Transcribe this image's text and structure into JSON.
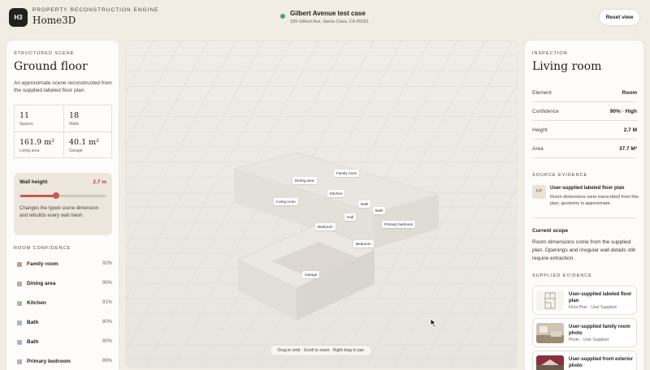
{
  "header": {
    "logo_text": "H3",
    "eyebrow": "PROPERTY RECONSTRUCTION ENGINE",
    "brand": "Home3D",
    "case_title": "Gilbert Avenue test case",
    "case_address": "189 Gilbert Ave, Santa Clara, CA 95051",
    "case_status_color": "#4fa36a",
    "reset_label": "Reset view"
  },
  "scene": {
    "eyebrow": "STRUCTURED SCENE",
    "title": "Ground floor",
    "description": "An approximate scene reconstructed from the supplied labeled floor plan.",
    "stats": [
      {
        "value": "11",
        "label": "Spaces"
      },
      {
        "value": "18",
        "label": "Walls"
      },
      {
        "value": "161.9 m²",
        "label": "Living area"
      },
      {
        "value": "40.1 m²",
        "label": "Garage"
      }
    ],
    "wall_height": {
      "label": "Wall height",
      "value_text": "2.7 m",
      "level_fraction": 0.42,
      "description": "Changes the typed scene dimension and rebuilds every wall mesh."
    },
    "room_confidence_title": "ROOM CONFIDENCE",
    "rooms": [
      {
        "name": "Family room",
        "pct": "92%",
        "color": "#b9a48c"
      },
      {
        "name": "Dining area",
        "pct": "90%",
        "color": "#c7aa94"
      },
      {
        "name": "Kitchen",
        "pct": "91%",
        "color": "#a9bba0"
      },
      {
        "name": "Bath",
        "pct": "80%",
        "color": "#a7b7c3"
      },
      {
        "name": "Bath",
        "pct": "80%",
        "color": "#a7b7c3"
      },
      {
        "name": "Primary bedroom",
        "pct": "86%",
        "color": "#b3aecb"
      }
    ]
  },
  "viewport": {
    "labels": [
      "Dining area",
      "Family room",
      "Kitchen",
      "Living room",
      "Bath",
      "Bath",
      "Hall",
      "Primary bedroom",
      "Bedroom",
      "Bedroom",
      "Garage"
    ],
    "hint": "Drag to orbit · Scroll to zoom · Right drag to pan"
  },
  "inspection": {
    "eyebrow": "INSPECTION",
    "title": "Living room",
    "rows": [
      {
        "key": "Element",
        "value": "Room"
      },
      {
        "key": "Confidence",
        "value": "90% · High"
      },
      {
        "key": "Height",
        "value": "2.7 M"
      },
      {
        "key": "Area",
        "value": "37.7 M²"
      }
    ],
    "source_title": "SOURCE EVIDENCE",
    "source_badge": "FP",
    "source_name": "User-supplied labeled floor plan",
    "source_desc": "Room dimensions were transcribed from this plan; geometry is approximate.",
    "scope_title": "Current scope",
    "scope_text": "Room dimensions come from the supplied plan. Openings and irregular wall details still require extraction.",
    "supplied_title": "SUPPLIED EVIDENCE",
    "supplied": [
      {
        "title": "User-supplied labeled floor plan",
        "sub": "Floor Plan · User Supplied",
        "thumb": "floorplan-thumbnail"
      },
      {
        "title": "User-supplied family room photo",
        "sub": "Photo · User Supplied",
        "thumb": "room-photo-thumbnail"
      },
      {
        "title": "User-supplied front exterior photo",
        "sub": "",
        "thumb": "exterior-photo-thumbnail"
      }
    ]
  },
  "colors": {
    "accent": "#c9584d",
    "accent_text": "#b0413a",
    "background": "#f1ece4"
  }
}
